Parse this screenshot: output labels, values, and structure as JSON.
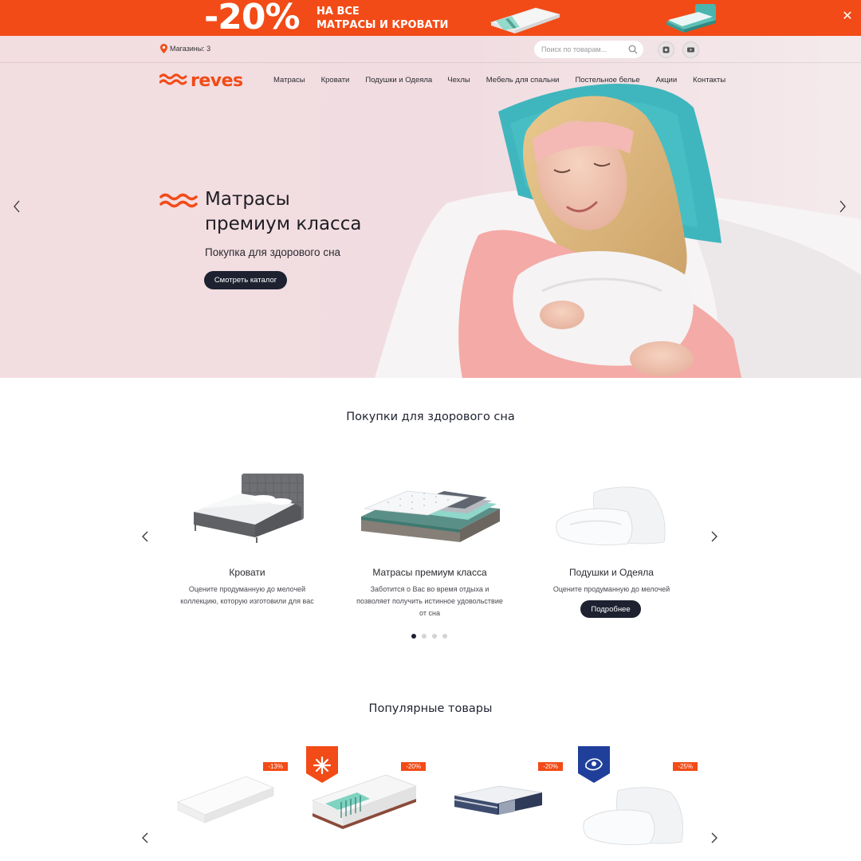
{
  "promo": {
    "discount": "-20%",
    "line1": "НА ВСЕ",
    "line2": "МАТРАСЫ И КРОВАТИ",
    "close_icon": "close-icon"
  },
  "topbar": {
    "stores_label": "Магазины: 3",
    "search_placeholder": "Поиск по товарам...",
    "social": [
      "instagram-icon",
      "youtube-icon"
    ]
  },
  "logo": {
    "text": "reves"
  },
  "nav": {
    "items": [
      "Матрасы",
      "Кровати",
      "Подушки и Одеяла",
      "Чехлы",
      "Мебель для спальни",
      "Постельное белье",
      "Акции",
      "Контакты"
    ]
  },
  "hero": {
    "title_line1": "Матрасы",
    "title_line2": "премиум класса",
    "subtitle": "Покупка для здорового сна",
    "button": "Смотреть каталог"
  },
  "categories": {
    "title": "Покупки для здорового сна",
    "items": [
      {
        "name": "Кровати",
        "desc_line1": "Оцените продуманную до мелочей",
        "desc_line2": "коллекцию, которую изготовили для вас"
      },
      {
        "name": "Матрасы премиум класса",
        "desc_line1": "Заботится о Вас во время отдыха и",
        "desc_line2": "позволяет получить истинное удовольствие",
        "desc_line3": "от сна"
      },
      {
        "name": "Подушки и Одеяла",
        "desc_line1": "Оцените продуманную до мелочей",
        "button": "Подробнее"
      }
    ],
    "slider_dots": 4,
    "active_dot": 1
  },
  "popular": {
    "title": "Популярные товары",
    "products": [
      {
        "badge": "-13%"
      },
      {
        "badge": "-20%"
      },
      {
        "badge": "-20%"
      },
      {
        "badge": "-25%"
      }
    ]
  },
  "colors": {
    "brand": "#f24b17",
    "dark": "#1d2130",
    "hero_bg": "#f3dfe3"
  }
}
